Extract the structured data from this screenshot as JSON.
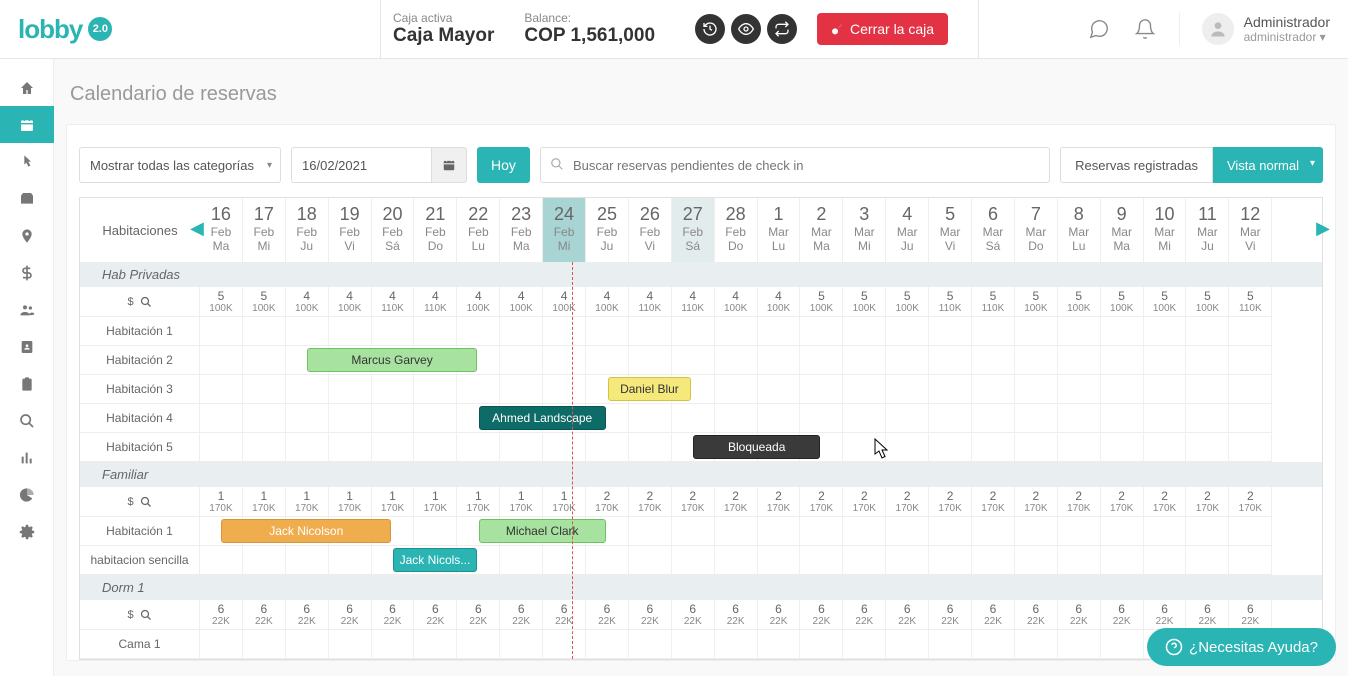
{
  "logo": {
    "text": "lobby",
    "badge": "2.0"
  },
  "register": {
    "active_label": "Caja activa",
    "active_value": "Caja Mayor",
    "balance_label": "Balance:",
    "balance_value": "COP 1,561,000",
    "close_label": "Cerrar la caja"
  },
  "user": {
    "name": "Administrador",
    "role": "administrador"
  },
  "page_title": "Calendario de reservas",
  "toolbar": {
    "category_select": "Mostrar todas las categorías",
    "date_value": "16/02/2021",
    "today": "Hoy",
    "search_placeholder": "Buscar reservas pendientes de check in",
    "registered": "Reservas registradas",
    "view": "Vista normal"
  },
  "calendar": {
    "rooms_label": "Habitaciones",
    "dates": [
      {
        "d": "16",
        "m": "Feb",
        "w": "Ma"
      },
      {
        "d": "17",
        "m": "Feb",
        "w": "Mi"
      },
      {
        "d": "18",
        "m": "Feb",
        "w": "Ju"
      },
      {
        "d": "19",
        "m": "Feb",
        "w": "Vi"
      },
      {
        "d": "20",
        "m": "Feb",
        "w": "Sá"
      },
      {
        "d": "21",
        "m": "Feb",
        "w": "Do"
      },
      {
        "d": "22",
        "m": "Feb",
        "w": "Lu"
      },
      {
        "d": "23",
        "m": "Feb",
        "w": "Ma"
      },
      {
        "d": "24",
        "m": "Feb",
        "w": "Mi",
        "today": true
      },
      {
        "d": "25",
        "m": "Feb",
        "w": "Ju"
      },
      {
        "d": "26",
        "m": "Feb",
        "w": "Vi"
      },
      {
        "d": "27",
        "m": "Feb",
        "w": "Sá",
        "holiday": true
      },
      {
        "d": "28",
        "m": "Feb",
        "w": "Do"
      },
      {
        "d": "1",
        "m": "Mar",
        "w": "Lu"
      },
      {
        "d": "2",
        "m": "Mar",
        "w": "Ma"
      },
      {
        "d": "3",
        "m": "Mar",
        "w": "Mi"
      },
      {
        "d": "4",
        "m": "Mar",
        "w": "Ju"
      },
      {
        "d": "5",
        "m": "Mar",
        "w": "Vi"
      },
      {
        "d": "6",
        "m": "Mar",
        "w": "Sá"
      },
      {
        "d": "7",
        "m": "Mar",
        "w": "Do"
      },
      {
        "d": "8",
        "m": "Mar",
        "w": "Lu"
      },
      {
        "d": "9",
        "m": "Mar",
        "w": "Ma"
      },
      {
        "d": "10",
        "m": "Mar",
        "w": "Mi"
      },
      {
        "d": "11",
        "m": "Mar",
        "w": "Ju"
      },
      {
        "d": "12",
        "m": "Mar",
        "w": "Vi"
      }
    ],
    "categories": [
      {
        "name": "Hab Privadas",
        "avail": [
          {
            "a": "5",
            "p": "100K"
          },
          {
            "a": "5",
            "p": "100K"
          },
          {
            "a": "4",
            "p": "100K"
          },
          {
            "a": "4",
            "p": "100K"
          },
          {
            "a": "4",
            "p": "110K"
          },
          {
            "a": "4",
            "p": "110K"
          },
          {
            "a": "4",
            "p": "100K"
          },
          {
            "a": "4",
            "p": "100K"
          },
          {
            "a": "4",
            "p": "100K"
          },
          {
            "a": "4",
            "p": "100K"
          },
          {
            "a": "4",
            "p": "110K"
          },
          {
            "a": "4",
            "p": "110K"
          },
          {
            "a": "4",
            "p": "100K"
          },
          {
            "a": "4",
            "p": "100K"
          },
          {
            "a": "5",
            "p": "100K"
          },
          {
            "a": "5",
            "p": "100K"
          },
          {
            "a": "5",
            "p": "100K"
          },
          {
            "a": "5",
            "p": "110K"
          },
          {
            "a": "5",
            "p": "110K"
          },
          {
            "a": "5",
            "p": "100K"
          },
          {
            "a": "5",
            "p": "100K"
          },
          {
            "a": "5",
            "p": "100K"
          },
          {
            "a": "5",
            "p": "100K"
          },
          {
            "a": "5",
            "p": "100K"
          },
          {
            "a": "5",
            "p": "110K"
          }
        ],
        "rooms": [
          {
            "label": "Habitación 1",
            "bookings": []
          },
          {
            "label": "Habitación 2",
            "bookings": [
              {
                "guest": "Marcus Garvey",
                "start": 2,
                "span": 4,
                "cls": "b-green-l"
              }
            ]
          },
          {
            "label": "Habitación 3",
            "bookings": [
              {
                "guest": "Daniel Blur",
                "start": 9,
                "span": 2,
                "cls": "b-yellow"
              }
            ]
          },
          {
            "label": "Habitación 4",
            "bookings": [
              {
                "guest": "Ahmed Landscape",
                "start": 6,
                "span": 3,
                "cls": "b-green-d"
              }
            ]
          },
          {
            "label": "Habitación 5",
            "bookings": [
              {
                "guest": "Bloqueada",
                "start": 11,
                "span": 3,
                "cls": "b-black"
              }
            ]
          }
        ]
      },
      {
        "name": "Familiar",
        "avail": [
          {
            "a": "1",
            "p": "170K"
          },
          {
            "a": "1",
            "p": "170K"
          },
          {
            "a": "1",
            "p": "170K"
          },
          {
            "a": "1",
            "p": "170K"
          },
          {
            "a": "1",
            "p": "170K"
          },
          {
            "a": "1",
            "p": "170K"
          },
          {
            "a": "1",
            "p": "170K"
          },
          {
            "a": "1",
            "p": "170K"
          },
          {
            "a": "1",
            "p": "170K"
          },
          {
            "a": "2",
            "p": "170K"
          },
          {
            "a": "2",
            "p": "170K"
          },
          {
            "a": "2",
            "p": "170K"
          },
          {
            "a": "2",
            "p": "170K"
          },
          {
            "a": "2",
            "p": "170K"
          },
          {
            "a": "2",
            "p": "170K"
          },
          {
            "a": "2",
            "p": "170K"
          },
          {
            "a": "2",
            "p": "170K"
          },
          {
            "a": "2",
            "p": "170K"
          },
          {
            "a": "2",
            "p": "170K"
          },
          {
            "a": "2",
            "p": "170K"
          },
          {
            "a": "2",
            "p": "170K"
          },
          {
            "a": "2",
            "p": "170K"
          },
          {
            "a": "2",
            "p": "170K"
          },
          {
            "a": "2",
            "p": "170K"
          },
          {
            "a": "2",
            "p": "170K"
          }
        ],
        "rooms": [
          {
            "label": "Habitación 1",
            "bookings": [
              {
                "guest": "Jack Nicolson",
                "start": 0,
                "span": 4,
                "cls": "b-orange"
              },
              {
                "guest": "Michael Clark",
                "start": 6,
                "span": 3,
                "cls": "b-green-l"
              }
            ]
          },
          {
            "label": "habitacion sencilla",
            "bookings": [
              {
                "guest": "Jack Nicols...",
                "start": 4,
                "span": 2,
                "cls": "b-teal"
              }
            ]
          }
        ]
      },
      {
        "name": "Dorm 1",
        "avail": [
          {
            "a": "6",
            "p": "22K"
          },
          {
            "a": "6",
            "p": "22K"
          },
          {
            "a": "6",
            "p": "22K"
          },
          {
            "a": "6",
            "p": "22K"
          },
          {
            "a": "6",
            "p": "22K"
          },
          {
            "a": "6",
            "p": "22K"
          },
          {
            "a": "6",
            "p": "22K"
          },
          {
            "a": "6",
            "p": "22K"
          },
          {
            "a": "6",
            "p": "22K"
          },
          {
            "a": "6",
            "p": "22K"
          },
          {
            "a": "6",
            "p": "22K"
          },
          {
            "a": "6",
            "p": "22K"
          },
          {
            "a": "6",
            "p": "22K"
          },
          {
            "a": "6",
            "p": "22K"
          },
          {
            "a": "6",
            "p": "22K"
          },
          {
            "a": "6",
            "p": "22K"
          },
          {
            "a": "6",
            "p": "22K"
          },
          {
            "a": "6",
            "p": "22K"
          },
          {
            "a": "6",
            "p": "22K"
          },
          {
            "a": "6",
            "p": "22K"
          },
          {
            "a": "6",
            "p": "22K"
          },
          {
            "a": "6",
            "p": "22K"
          },
          {
            "a": "6",
            "p": "22K"
          },
          {
            "a": "6",
            "p": "22K"
          },
          {
            "a": "6",
            "p": "22K"
          }
        ],
        "rooms": [
          {
            "label": "Cama 1",
            "bookings": []
          }
        ]
      }
    ]
  },
  "help": "¿Necesitas Ayuda?"
}
